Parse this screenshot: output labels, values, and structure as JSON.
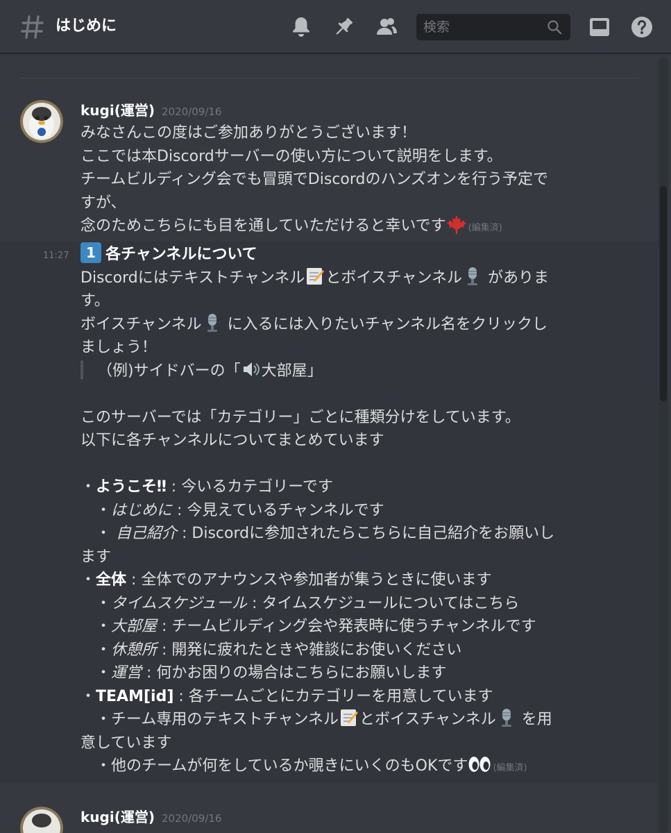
{
  "header": {
    "channel_name": "はじめに",
    "search_placeholder": "検索"
  },
  "messages": [
    {
      "author": "kugi(運営)",
      "timestamp": "2020/09/16",
      "lines": [
        "みなさんこの度はご参加ありがとうございます！",
        "ここでは本Discordサーバーの使い方について説明をします。",
        "チームビルディング会でも冒頭でDiscordのハンズオンを行う予定で",
        "すが、",
        "念のためこちらにも目を通していただけると幸いです"
      ],
      "edited": "(編集済)"
    },
    {
      "side_time": "11:27",
      "keycap": "1",
      "title": "各チャンネルについて",
      "lines": {
        "l1a": "Discordにはテキストチャンネル",
        "l1b": "とボイスチャンネル",
        "l1c": " がありま",
        "l2": "す。",
        "l3a": "ボイスチャンネル",
        "l3b": " に入るには入りたいチャンネル名をクリックし",
        "l4": "ましょう！",
        "quote_a": "（例)サイドバーの「",
        "quote_b": "大部屋」",
        "l6": "このサーバーでは「カテゴリー」ごとに種類分けをしています。",
        "l7": "以下に各チャンネルについてまとめています",
        "w_bullet": "・",
        "w_name": "ようこそ‼",
        "w_desc": " : 今いるカテゴリーです",
        "h_bullet": "　・",
        "h_name": "はじめに",
        "h_desc": " : 今見えているチャンネルです",
        "j_bullet": "　・ ",
        "j_name": "自己紹介",
        "j_desc": " : Discordに参加されたらこちらに自己紹介をお願いし",
        "j_cont": "ます",
        "z_bullet": "・",
        "z_name": "全体",
        "z_desc": " : 全体でのアナウンスや参加者が集うときに使います",
        "t_bullet": "　・",
        "t_name": "タイムスケジュール",
        "t_desc": " : タイムスケジュールについてはこちら",
        "d_bullet": "　・",
        "d_name": "大部屋",
        "d_desc": " : チームビルディング会や発表時に使うチャンネルです",
        "k_bullet": "　・",
        "k_name": "休憩所",
        "k_desc": " : 開発に疲れたときや雑談にお使いください",
        "u_bullet": "　・",
        "u_name": "運営",
        "u_desc": " : 何かお困りの場合はこちらにお願いします",
        "team_bullet": "・",
        "team_name": "TEAM[id]",
        "team_desc": " : 各チームごとにカテゴリーを用意しています",
        "tc_a": "　・チーム専用のテキストチャンネル",
        "tc_b": "とボイスチャンネル",
        "tc_c": " を用",
        "tc_cont": "意しています",
        "other": "　・他のチームが何をしているか覗きにいくのもOKです"
      },
      "edited": "(編集済)"
    },
    {
      "author": "kugi(運営)",
      "timestamp": "2020/09/16"
    }
  ],
  "icons": [
    "hash-icon",
    "bell-icon",
    "pin-icon",
    "members-icon",
    "search-icon",
    "inbox-icon",
    "help-icon",
    "maple-leaf-icon",
    "memo-icon",
    "microphone-icon",
    "speaker-icon",
    "eyes-icon"
  ],
  "colors": {
    "background": "#36393f",
    "hover_background": "#32353b",
    "header_text": "#ffffff",
    "body_text": "#dcddde",
    "muted": "#72767d",
    "keycap": "#3b88c3"
  }
}
